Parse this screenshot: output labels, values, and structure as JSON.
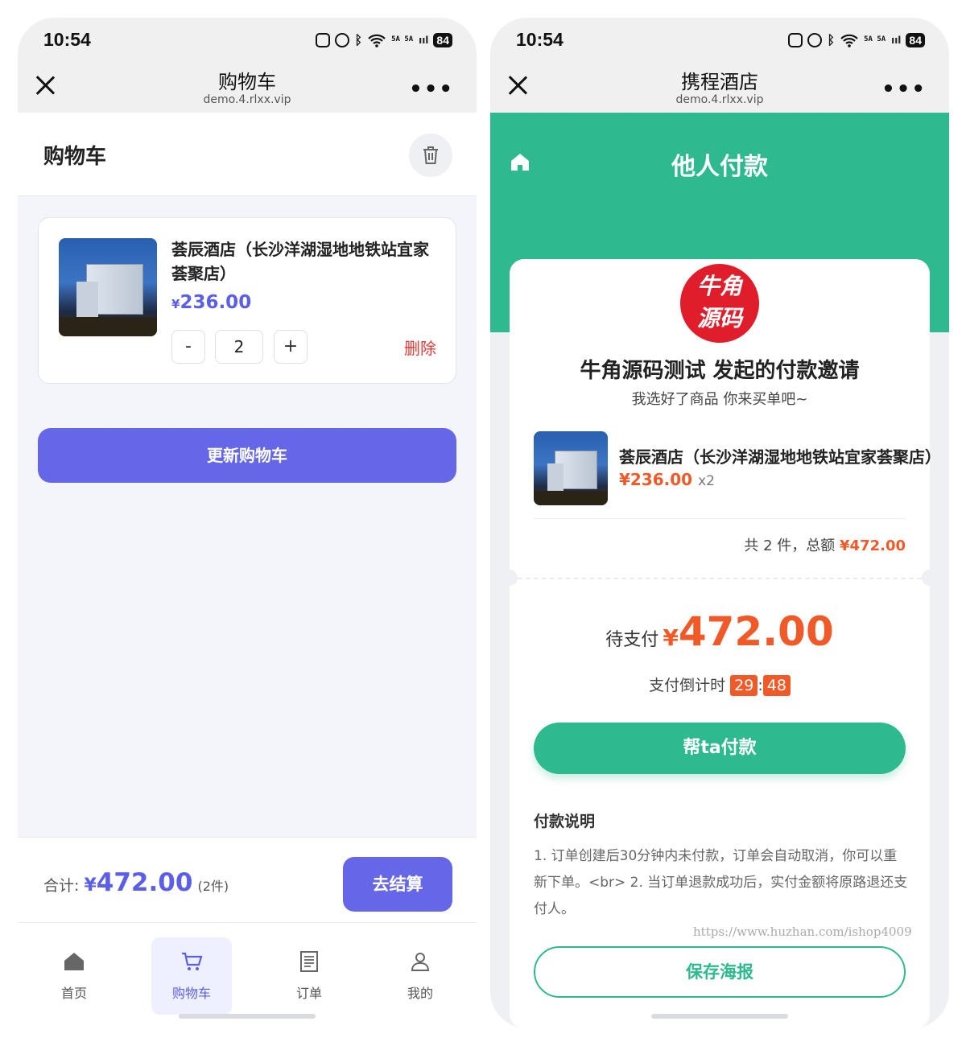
{
  "left": {
    "status": {
      "time": "10:54",
      "battery": "84",
      "signal": "5A 5A"
    },
    "nav": {
      "title": "购物车",
      "domain": "demo.4.rlxx.vip",
      "more": "•••"
    },
    "header": {
      "title": "购物车"
    },
    "item": {
      "name": "荟辰酒店（长沙洋湖湿地地铁站宜家荟聚店）",
      "currency": "¥",
      "price": "236.00",
      "minus": "-",
      "qty": "2",
      "plus": "+",
      "delete": "删除"
    },
    "update_label": "更新购物车",
    "footer": {
      "total_label": "合计:",
      "currency": "¥",
      "total": "472.00",
      "count": "(2件)",
      "checkout": "去结算"
    },
    "tabs": [
      {
        "label": "首页",
        "icon": "home-icon"
      },
      {
        "label": "购物车",
        "icon": "cart-icon",
        "active": true
      },
      {
        "label": "订单",
        "icon": "order-icon"
      },
      {
        "label": "我的",
        "icon": "user-icon"
      }
    ]
  },
  "right": {
    "status": {
      "time": "10:54",
      "battery": "84",
      "signal": "5A 5A"
    },
    "nav": {
      "title": "携程酒店",
      "domain": "demo.4.rlxx.vip",
      "more": "•••"
    },
    "banner_title": "他人付款",
    "logo": {
      "line1": "牛角",
      "line2": "源码"
    },
    "invite": {
      "title": "牛角源码测试 发起的付款邀请",
      "subtitle": "我选好了商品 你来买单吧~"
    },
    "product": {
      "name": "荟辰酒店（长沙洋湖湿地地铁站宜家荟聚店）",
      "price": "¥236.00",
      "qty": "x2"
    },
    "summary": {
      "prefix": "共 2 件，总额",
      "total": "¥472.00"
    },
    "due": {
      "label": "待支付",
      "currency": "¥",
      "amount": "472.00"
    },
    "countdown": {
      "label": "支付倒计时",
      "min": "29",
      "sep": ":",
      "sec": "48"
    },
    "pay_label": "帮ta付款",
    "notes": {
      "title": "付款说明",
      "text": "1. 订单创建后30分钟内未付款，订单会自动取消，你可以重新下单。<br> 2. 当订单退款成功后，实付金额将原路退还支付人。"
    },
    "watermark": "https://www.huzhan.com/ishop4009",
    "save_label": "保存海报"
  },
  "colors": {
    "primary": "#6667e8",
    "green": "#2eba8e",
    "orange": "#f05a28",
    "delete": "#e53935"
  }
}
